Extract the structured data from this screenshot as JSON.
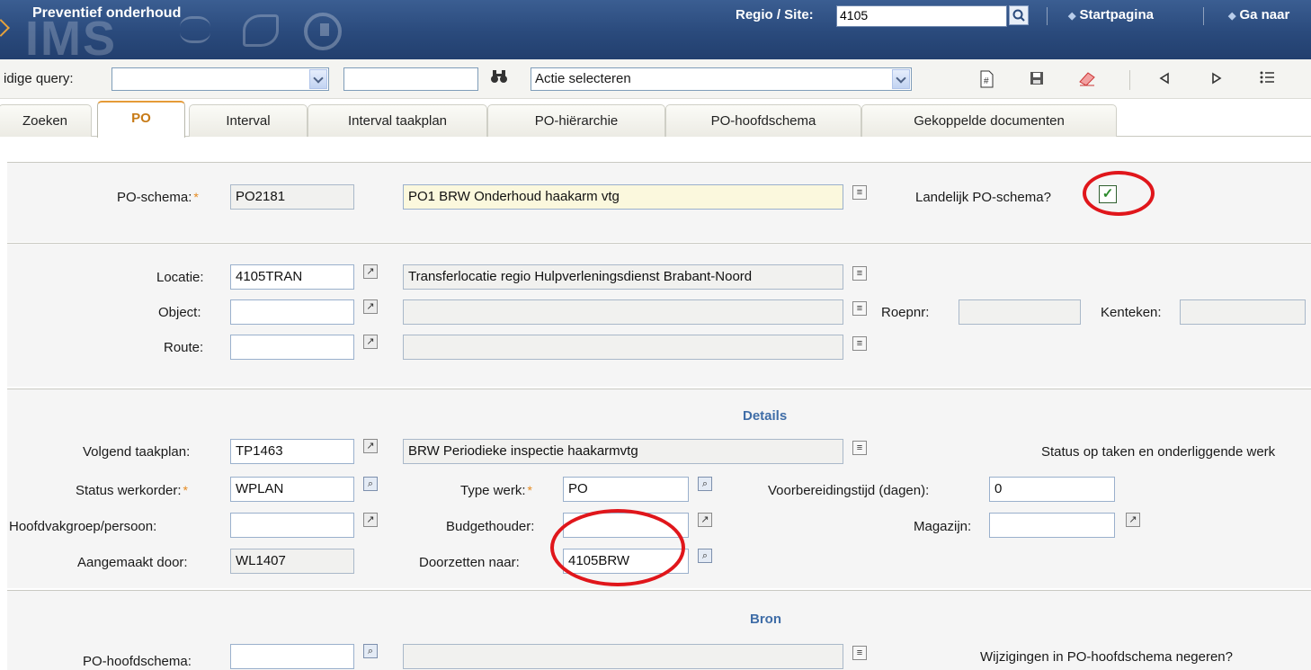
{
  "header": {
    "app_title": "Preventief onderhoud",
    "watermark": "IMS",
    "site_label": "Regio / Site:",
    "site_value": "4105",
    "nav_start": "Startpagina",
    "nav_goto": "Ga naar"
  },
  "toolbar": {
    "query_label": "idige query:",
    "query_value": "",
    "action_placeholder": "Actie selecteren"
  },
  "tabs": [
    "Zoeken",
    "PO",
    "Interval",
    "Interval taakplan",
    "PO-hiërarchie",
    "PO-hoofdschema",
    "Gekoppelde documenten"
  ],
  "schema": {
    "label": "PO-schema:",
    "code": "PO2181",
    "description": "PO1 BRW Onderhoud haakarm vtg",
    "national_label": "Landelijk PO-schema?"
  },
  "location": {
    "locatie_label": "Locatie:",
    "locatie_code": "4105TRAN",
    "locatie_desc": "Transferlocatie regio Hulpverleningsdienst Brabant-Noord",
    "object_label": "Object:",
    "object_code": "",
    "object_desc": "",
    "route_label": "Route:",
    "route_code": "",
    "route_desc": "",
    "roepnr_label": "Roepnr:",
    "kenteken_label": "Kenteken:"
  },
  "details": {
    "title": "Details",
    "taakplan_label": "Volgend taakplan:",
    "taakplan_code": "TP1463",
    "taakplan_desc": "BRW Periodieke inspectie haakarmvtg",
    "status_note": "Status op taken en onderliggende werk",
    "status_label": "Status werkorder:",
    "status_value": "WPLAN",
    "type_label": "Type werk:",
    "type_value": "PO",
    "prep_label": "Voorbereidingstijd (dagen):",
    "prep_value": "0",
    "hoofdvak_label": "Hoofdvakgroep/persoon:",
    "hoofdvak_value": "",
    "budget_label": "Budgethouder:",
    "budget_value": "",
    "magazijn_label": "Magazijn:",
    "magazijn_value": "",
    "created_label": "Aangemaakt door:",
    "created_value": "WL1407",
    "forward_label": "Doorzetten naar:",
    "forward_value": "4105BRW"
  },
  "bron": {
    "title": "Bron",
    "hoofdschema_label": "PO-hoofdschema:",
    "hoofdschema_value": "",
    "hoofdschema_desc": "",
    "ignore_label": "Wijzigingen in PO-hoofdschema negeren?"
  }
}
